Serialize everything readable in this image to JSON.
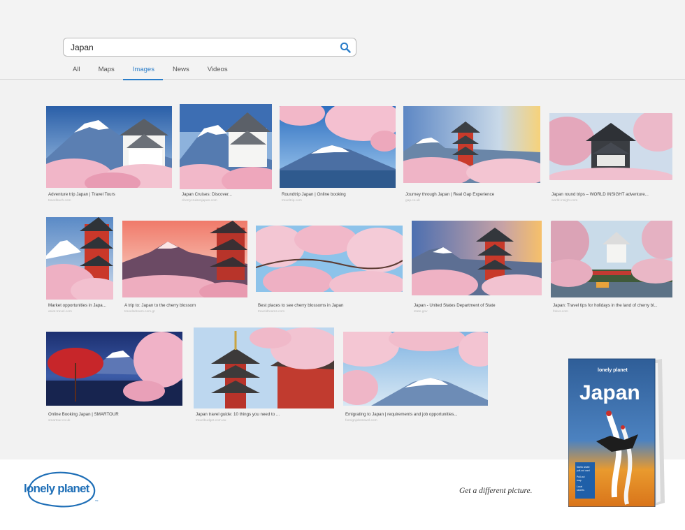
{
  "search": {
    "query": "Japan"
  },
  "tabs": [
    "All",
    "Maps",
    "Images",
    "News",
    "Videos"
  ],
  "active_tab": "Images",
  "results": [
    {
      "title": "Adventure trip Japan | Travel Tours",
      "source": "travelbuch.com"
    },
    {
      "title": "Japan Cruises: Discover...",
      "source": "cherrycruisesjapan.com"
    },
    {
      "title": "Roundtrip Japan | Online booking",
      "source": "traveltrip.com"
    },
    {
      "title": "Journey through Japan | Real Gap Experience",
      "source": "gap.co.uk"
    },
    {
      "title": "Japan round trips – WORLD INSIGHT adventure...",
      "source": "world-insight.com"
    },
    {
      "title": "Market opportunities in Japa...",
      "source": "asiat-travel.com"
    },
    {
      "title": "A trip to: Japan to the cherry blossom",
      "source": "travelsdream.com.gr"
    },
    {
      "title": "Best places to see cherry blossoms in Japan",
      "source": "traveldreams.com"
    },
    {
      "title": "Japan - United States Department of State",
      "source": "state.gov"
    },
    {
      "title": "Japan: Travel tips for holidays in the land of cherry bl...",
      "source": "fokus.com"
    },
    {
      "title": "Online Booking Japan | SMARTOUR",
      "source": "smartour.co.uk"
    },
    {
      "title": "Japan travel guide: 10 things you need to ...",
      "source": "travelbudget.com.au"
    },
    {
      "title": "Emigrating to Japan | requirements and job opportunities...",
      "source": "foreignjobstravel.com"
    }
  ],
  "brand": {
    "logo": "lonely planet",
    "tagline": "Get a different picture.",
    "book_publisher": "lonely planet",
    "book_title": "Japan",
    "book_features": [
      "Norito smart pull-out card",
      "Pull-out map",
      "Local secrets"
    ]
  },
  "colors": {
    "accent": "#2a7dc9",
    "logo_blue": "#1f6fb7",
    "book_blue": "#3f73b0",
    "book_orange": "#e5861f"
  },
  "icons": {
    "search": "magnifier-icon"
  }
}
